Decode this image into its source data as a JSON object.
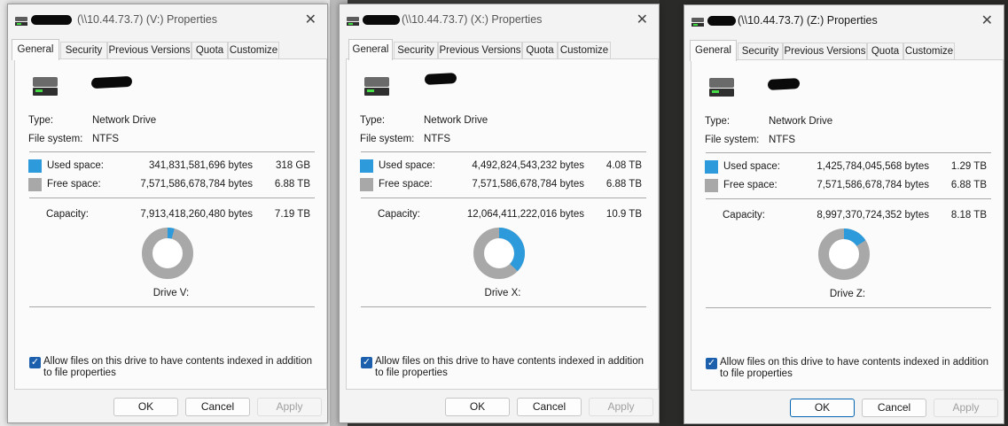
{
  "colors": {
    "used": "#2c9adb",
    "free": "#a8a8a8"
  },
  "common": {
    "tabs": [
      "General",
      "Security",
      "Previous Versions",
      "Quota",
      "Customize"
    ],
    "type_label": "Type:",
    "fs_label": "File system:",
    "used_label": "Used space:",
    "free_label": "Free space:",
    "capacity_label": "Capacity:",
    "checkbox_label": "Allow files on this drive to have contents indexed in addition to file properties",
    "ok_label": "OK",
    "cancel_label": "Cancel",
    "apply_label": "Apply",
    "close_glyph": "✕",
    "check_glyph": "✓"
  },
  "dialogs": [
    {
      "title": "(\\\\10.44.73.7) (V:) Properties",
      "type": "Network Drive",
      "file_system": "NTFS",
      "used_bytes": "341,831,581,696 bytes",
      "used_short": "318 GB",
      "free_bytes": "7,571,586,678,784 bytes",
      "free_short": "6.88 TB",
      "capacity_bytes": "7,913,418,260,480 bytes",
      "capacity_short": "7.19 TB",
      "drive_label": "Drive V:",
      "used_fraction": 0.0432
    },
    {
      "title": "(\\\\10.44.73.7) (X:) Properties",
      "type": "Network Drive",
      "file_system": "NTFS",
      "used_bytes": "4,492,824,543,232 bytes",
      "used_short": "4.08 TB",
      "free_bytes": "7,571,586,678,784 bytes",
      "free_short": "6.88 TB",
      "capacity_bytes": "12,064,411,222,016 bytes",
      "capacity_short": "10.9 TB",
      "drive_label": "Drive X:",
      "used_fraction": 0.3724
    },
    {
      "title": "(\\\\10.44.73.7) (Z:) Properties",
      "type": "Network Drive",
      "file_system": "NTFS",
      "used_bytes": "1,425,784,045,568 bytes",
      "used_short": "1.29 TB",
      "free_bytes": "7,571,586,678,784 bytes",
      "free_short": "6.88 TB",
      "capacity_bytes": "8,997,370,724,352 bytes",
      "capacity_short": "8.18 TB",
      "drive_label": "Drive Z:",
      "used_fraction": 0.1585
    }
  ]
}
